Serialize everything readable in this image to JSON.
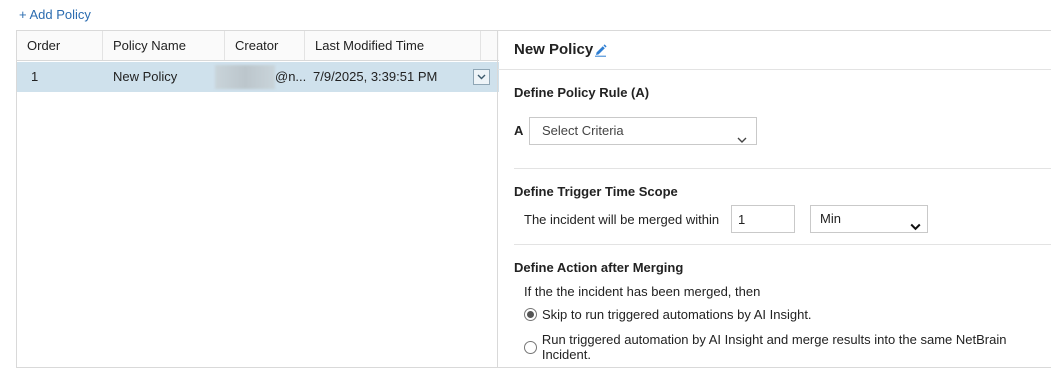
{
  "toolbar": {
    "add_policy_label": "+ Add Policy"
  },
  "table": {
    "columns": [
      "Order",
      "Policy Name",
      "Creator",
      "Last Modified Time"
    ],
    "rows": [
      {
        "order": "1",
        "name": "New Policy",
        "creator": "@n...",
        "modified": "7/9/2025, 3:39:51 PM"
      }
    ]
  },
  "detail": {
    "title": "New Policy",
    "rule": {
      "heading": "Define Policy Rule (A)",
      "letter": "A",
      "criteria_placeholder": "Select Criteria"
    },
    "scope": {
      "heading": "Define Trigger Time Scope",
      "text": "The incident will be merged within",
      "value": "1",
      "unit": "Min"
    },
    "action": {
      "heading": "Define Action after Merging",
      "text": "If the the incident has been merged, then",
      "options": [
        {
          "label": "Skip to run triggered automations by AI Insight.",
          "checked": true
        },
        {
          "label": "Run triggered automation by AI Insight and merge results into the same NetBrain Incident.",
          "checked": false
        }
      ]
    }
  },
  "colors": {
    "accent": "#2b6cb0",
    "selected_row": "#cfe1ec"
  }
}
